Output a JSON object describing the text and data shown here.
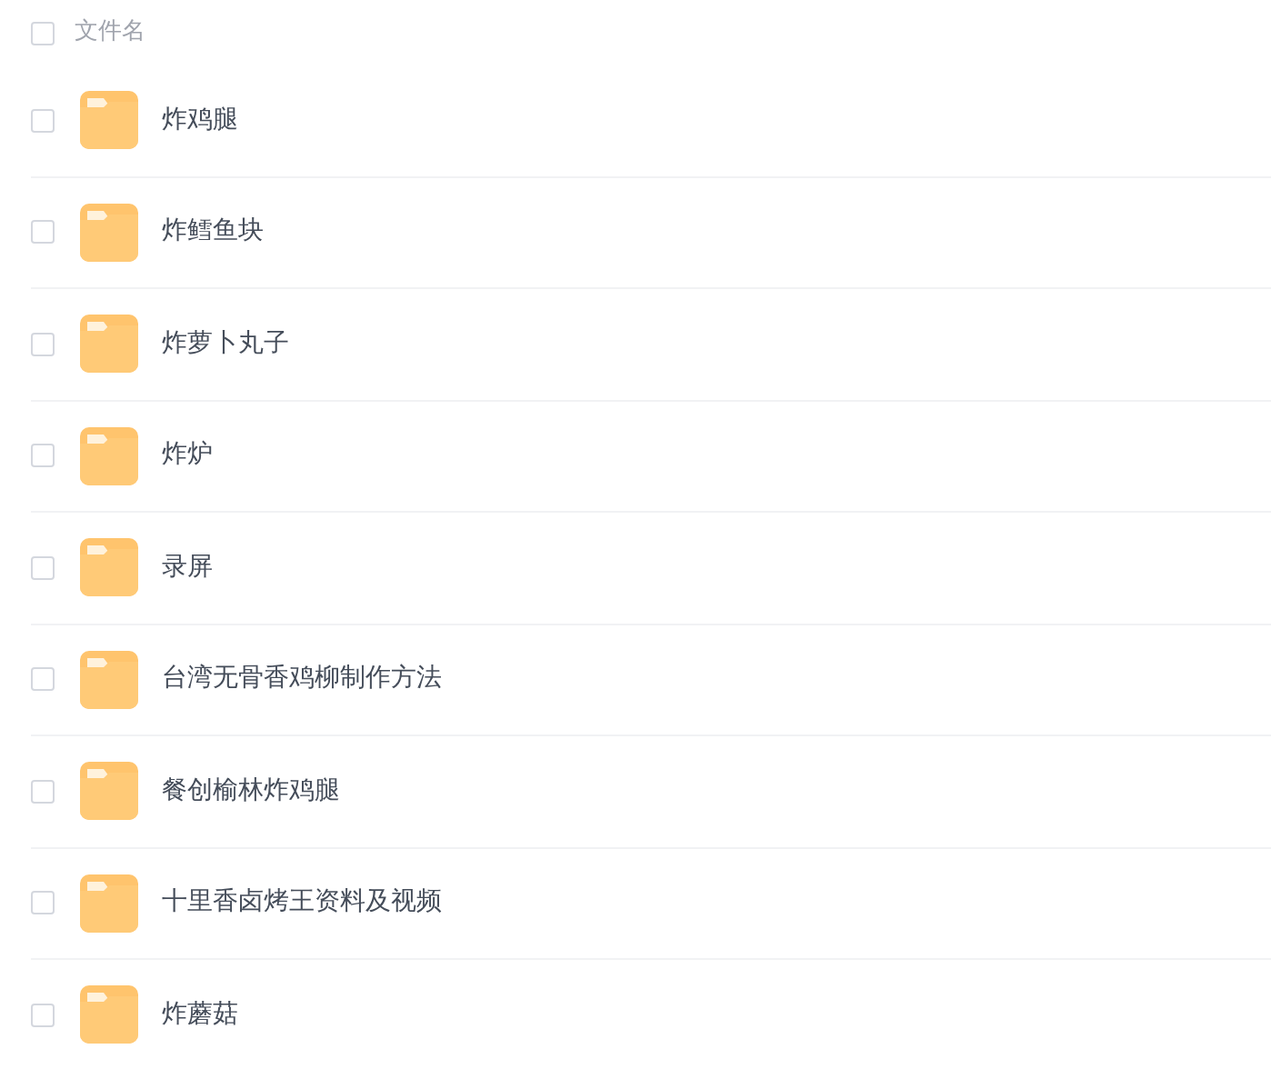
{
  "header": {
    "label": "文件名",
    "checked": false
  },
  "files": [
    {
      "name": "炸鸡腿",
      "checked": false
    },
    {
      "name": "炸鳕鱼块",
      "checked": false
    },
    {
      "name": "炸萝卜丸子",
      "checked": false
    },
    {
      "name": "炸炉",
      "checked": false
    },
    {
      "name": "录屏",
      "checked": false
    },
    {
      "name": "台湾无骨香鸡柳制作方法",
      "checked": false
    },
    {
      "name": "餐创榆林炸鸡腿",
      "checked": false
    },
    {
      "name": "十里香卤烤王资料及视频",
      "checked": false
    },
    {
      "name": "炸蘑菇",
      "checked": false
    }
  ]
}
